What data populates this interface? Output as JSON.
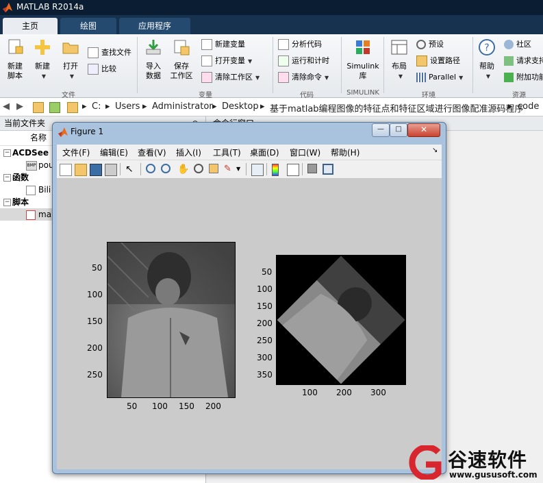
{
  "app": {
    "title": "MATLAB R2014a"
  },
  "tabs": [
    {
      "label": "主页",
      "active": true
    },
    {
      "label": "绘图",
      "active": false
    },
    {
      "label": "应用程序",
      "active": false
    }
  ],
  "ribbon": {
    "file_group": {
      "label": "文件",
      "new_script": "新建\n脚本",
      "new": "新建",
      "open": "打开",
      "find_files": "查找文件",
      "compare": "比较"
    },
    "variable_group": {
      "label": "变量",
      "import_data": "导入\n数据",
      "save_workspace": "保存\n工作区",
      "new_variable": "新建变量",
      "open_variable": "打开变量",
      "clear_workspace": "清除工作区"
    },
    "code_group": {
      "label": "代码",
      "analyze_code": "分析代码",
      "run_and_time": "运行和计时",
      "clear_commands": "清除命令"
    },
    "simulink_group": {
      "label": "SIMULINK",
      "library": "Simulink\n库"
    },
    "environment_group": {
      "label": "环境",
      "layout": "布局",
      "preferences": "预设",
      "set_path": "设置路径",
      "parallel": "Parallel"
    },
    "resources_group": {
      "label": "资源",
      "help": "帮助",
      "community": "社区",
      "request_support": "请求支持",
      "add_ons": "附加功能"
    }
  },
  "address": {
    "crumbs": [
      "C:",
      "Users",
      "Administrator",
      "Desktop",
      "基于matlab编程图像的特征点和特征区域进行图像配准源码程序",
      "code"
    ]
  },
  "current_folder": {
    "title": "当前文件夹",
    "column_name": "名称",
    "groups": [
      {
        "label": "ACDSee BMP",
        "items": [
          {
            "name": "pou"
          }
        ]
      },
      {
        "label": "函数",
        "items": [
          {
            "name": "Bili"
          }
        ]
      },
      {
        "label": "脚本",
        "items": [
          {
            "name": "ma"
          }
        ]
      }
    ]
  },
  "command_window": {
    "title": "命令行窗口"
  },
  "figure": {
    "title": "Figure 1",
    "menu": [
      "文件(F)",
      "编辑(E)",
      "查看(V)",
      "插入(I)",
      "工具(T)",
      "桌面(D)",
      "窗口(W)",
      "帮助(H)"
    ],
    "left_axes": {
      "yticks": [
        "50",
        "100",
        "150",
        "200",
        "250"
      ],
      "xticks": [
        "50",
        "100",
        "150",
        "200"
      ],
      "xlim": [
        0,
        230
      ],
      "ylim": [
        0,
        290
      ]
    },
    "right_axes": {
      "yticks": [
        "50",
        "100",
        "150",
        "200",
        "250",
        "300",
        "350"
      ],
      "xticks": [
        "100",
        "200",
        "300"
      ],
      "xlim": [
        0,
        375
      ],
      "ylim": [
        0,
        375
      ],
      "rotation_deg": 45
    }
  },
  "watermark": {
    "brand": "谷速软件",
    "url": "www.gususoft.com"
  },
  "colors": {
    "titlebar": "#0b1d33",
    "tabbar": "#17324f",
    "figure_bg": "#cbcbcb",
    "brand_red": "#d8262e"
  }
}
